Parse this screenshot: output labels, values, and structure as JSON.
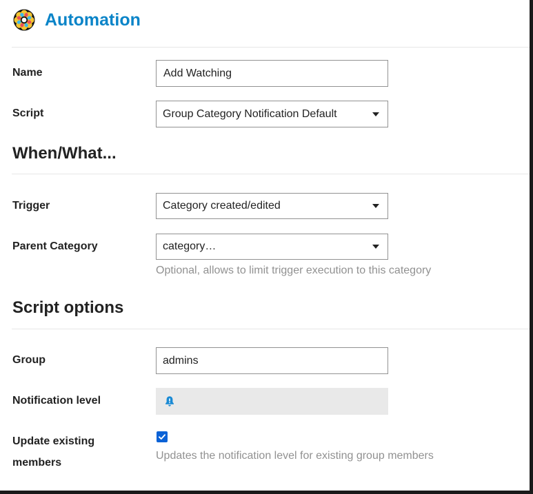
{
  "header": {
    "title": "Automation",
    "logo_icon": "flower-logo-icon"
  },
  "form": {
    "name": {
      "label": "Name",
      "value": "Add Watching"
    },
    "script": {
      "label": "Script",
      "value": "Group Category Notification Default"
    }
  },
  "when_what": {
    "heading": "When/What...",
    "trigger": {
      "label": "Trigger",
      "value": "Category created/edited"
    },
    "parent_category": {
      "label": "Parent Category",
      "value": "category…",
      "hint": "Optional, allows to limit trigger execution to this category"
    }
  },
  "script_options": {
    "heading": "Script options",
    "group": {
      "label": "Group",
      "value": "admins"
    },
    "notification_level": {
      "label": "Notification level",
      "icon": "bell-exclamation-icon"
    },
    "update_existing": {
      "label_line1": "Update existing",
      "label_line2": "members",
      "checked": true,
      "hint": "Updates the notification level for existing group members"
    }
  },
  "colors": {
    "title": "#0a84c8",
    "bell": "#1a8ad4",
    "checkbox": "#0b62d6",
    "hint": "#919191",
    "notification_bg": "#e9e9e9"
  }
}
